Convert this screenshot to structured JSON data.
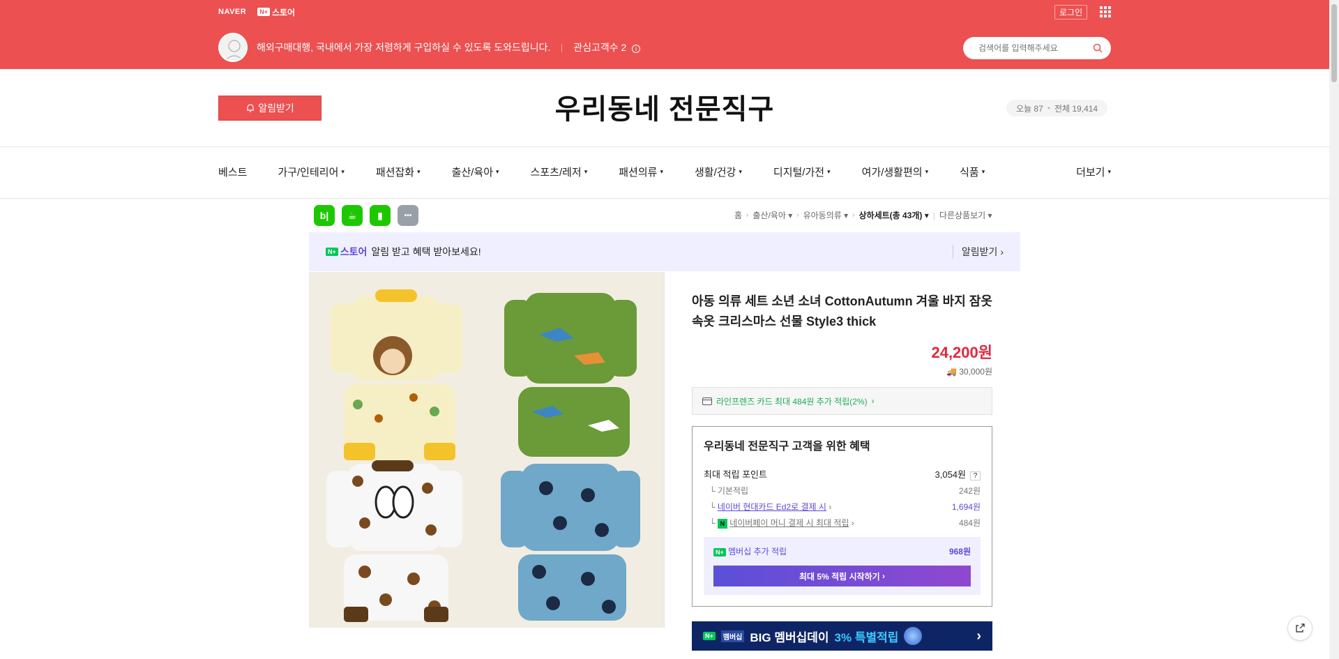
{
  "topbar": {
    "naver_label": "NAVER",
    "store_badge": "N+",
    "store_label": "스토어",
    "login_label": "로그인",
    "apps_icon": "grid-icon"
  },
  "storeinfo": {
    "description": "해외구매대행, 국내에서 가장 저렴하게 구입하실 수 있도록 도와드립니다.",
    "interest": "관심고객수 2",
    "search_placeholder": "검색어를 입력해주세요"
  },
  "header": {
    "alarm_label": "알림받기",
    "store_name": "우리동네 전문직구",
    "today_label": "오늘 87",
    "total_label": "전체 19,414"
  },
  "nav": {
    "items": [
      "베스트",
      "가구/인테리어",
      "패션잡화",
      "출산/육아",
      "스포츠/레저",
      "패션의류",
      "생활/건강",
      "디지털/가전",
      "여가/생활편의",
      "식품"
    ],
    "more_label": "더보기"
  },
  "share_icons": [
    {
      "name": "blog",
      "glyph": "b|",
      "color": "#1ec800"
    },
    {
      "name": "cafe",
      "glyph": "☕",
      "color": "#1ec800"
    },
    {
      "name": "bookmark",
      "glyph": "▮",
      "color": "#1ec800"
    },
    {
      "name": "more",
      "glyph": "•••",
      "color": "#9aa0a8"
    }
  ],
  "breadcrumb": {
    "home": "홈",
    "c1": "출산/육아",
    "c2": "유아동의류",
    "c3": "상하세트(총 43개)",
    "other": "다른상품보기"
  },
  "promo": {
    "brand_badge": "N+",
    "brand_label": "스토어",
    "text": "알림 받고 혜택 받아보세요!",
    "action": "알림받기"
  },
  "product": {
    "title": "아동 의류 세트 소년 소녀 CottonAutumn 겨울 바지 잠옷 속옷 크리스마스 선물 Style3 thick",
    "price": "24,200원",
    "shipping": "30,000원",
    "card_benefit": "라인프렌즈 카드 최대 484원 추가 적립(2%)"
  },
  "benefit": {
    "title": "우리동네 전문직구 고객을 위한 혜택",
    "max_label": "최대 적립 포인트",
    "max_value": "3,054원",
    "rows": [
      {
        "label": "기본적립",
        "value": "242원"
      },
      {
        "label": "네이버 현대카드 Ed2로 결제 시",
        "value": "1,694원"
      },
      {
        "label": "네이버페이 머니 결제 시 최대 적립",
        "value": "484원"
      }
    ],
    "member_label": "멤버십 추가 적립",
    "member_value": "968원",
    "cta": "최대 5% 적립 시작하기"
  },
  "bigbanner": {
    "badge": "N+",
    "badge_text": "멤버십",
    "text_pre": "BIG 멤버십데이",
    "text_hl": "3% 특별적립"
  },
  "colors": {
    "brand": "#ec5050",
    "accent_purple": "#5d48d7",
    "price": "#e3263c",
    "green": "#03c75a"
  }
}
